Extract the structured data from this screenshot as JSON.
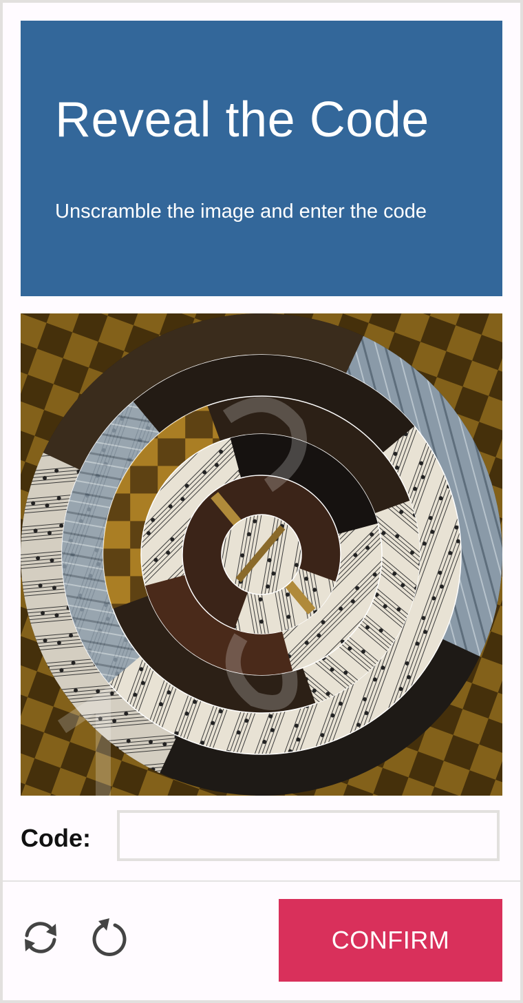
{
  "header": {
    "title": "Reveal the Code",
    "subtitle": "Unscramble the image and enter the code"
  },
  "puzzle": {
    "image": "scrambled-sheet-music-violin-photo",
    "ring_rotations_deg": [
      0,
      35,
      -60,
      20,
      -120,
      75
    ]
  },
  "form": {
    "code_label": "Code:",
    "code_value": "",
    "code_placeholder": ""
  },
  "footer": {
    "refresh_icon": "refresh-icon",
    "rotate_icon": "rotate-icon",
    "confirm_label": "CONFIRM"
  },
  "colors": {
    "header_bg": "#33679a",
    "confirm_bg": "#d9305b",
    "border": "#e2e0de",
    "page_bg": "#fffbff"
  }
}
